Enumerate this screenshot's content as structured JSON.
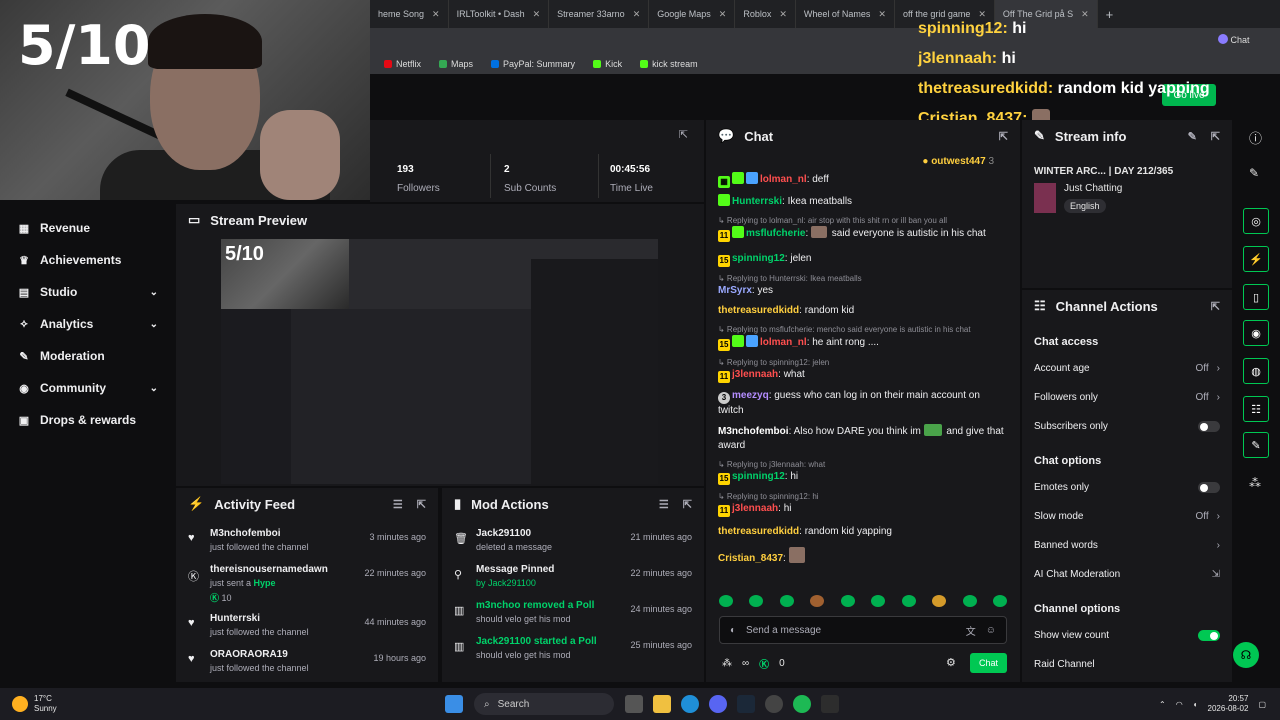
{
  "browser": {
    "tabs": [
      "heme Song",
      "IRLToolkit • Dash",
      "Streamer 33arno",
      "Google Maps",
      "Roblox",
      "Wheel of Names",
      "off the grid game",
      "Off The Grid på S"
    ],
    "bookmarks": [
      "Netflix",
      "Maps",
      "PayPal: Summary",
      "Kick",
      "kick stream"
    ],
    "chat_label": "Chat"
  },
  "overlay": {
    "score": "5/10",
    "chat": [
      {
        "user": "spinning12:",
        "msg": "hi"
      },
      {
        "user": "j3lennaah:",
        "msg": "hi"
      },
      {
        "user": "thetreasuredkidd:",
        "msg": "random kid yapping"
      },
      {
        "user": "Cristian_8437:",
        "msg": ""
      }
    ]
  },
  "topbar": {
    "go_live": "Go live"
  },
  "nav": {
    "items": [
      {
        "label": "Revenue",
        "icon": "revenue-icon",
        "chev": false
      },
      {
        "label": "Achievements",
        "icon": "trophy-icon",
        "chev": false
      },
      {
        "label": "Studio",
        "icon": "studio-icon",
        "chev": true
      },
      {
        "label": "Analytics",
        "icon": "analytics-icon",
        "chev": true
      },
      {
        "label": "Moderation",
        "icon": "wrench-icon",
        "chev": false
      },
      {
        "label": "Community",
        "icon": "community-icon",
        "chev": true
      },
      {
        "label": "Drops & rewards",
        "icon": "gift-icon",
        "chev": false
      }
    ]
  },
  "stats": [
    {
      "value": "193",
      "label": "Followers"
    },
    {
      "value": "2",
      "label": "Sub Counts"
    },
    {
      "value": "00:45:56",
      "label": "Time Live"
    }
  ],
  "preview": {
    "title": "Stream Preview",
    "score": "5/10"
  },
  "activity": {
    "title": "Activity Feed",
    "items": [
      {
        "name": "M3nchofemboi",
        "sub": "just followed the channel",
        "time": "3 minutes ago",
        "icon": "heart-icon",
        "extra": ""
      },
      {
        "name": "thereisnousernamedawn",
        "sub": "just sent a Hype",
        "time": "22 minutes ago",
        "icon": "kick-icon",
        "extra": "10"
      },
      {
        "name": "Hunterrski",
        "sub": "just followed the channel",
        "time": "44 minutes ago",
        "icon": "heart-icon",
        "extra": ""
      },
      {
        "name": "ORAORAORA19",
        "sub": "just followed the channel",
        "time": "19 hours ago",
        "icon": "heart-icon",
        "extra": ""
      }
    ]
  },
  "mod": {
    "title": "Mod Actions",
    "items": [
      {
        "name": "Jack291100",
        "sub": "deleted a message",
        "time": "21 minutes ago",
        "icon": "trash-icon",
        "green": false
      },
      {
        "name": "Message Pinned",
        "sub": "by Jack291100",
        "time": "22 minutes ago",
        "icon": "pin-icon",
        "green": false
      },
      {
        "name": "m3nchoo removed a Poll",
        "sub": "should velo get his mod",
        "time": "24 minutes ago",
        "icon": "poll-icon",
        "green": true
      },
      {
        "name": "Jack291100 started a Poll",
        "sub": "should velo get his mod",
        "time": "25 minutes ago",
        "icon": "poll-icon",
        "green": true
      }
    ]
  },
  "chat": {
    "title": "Chat",
    "pinned_user": "outwest447",
    "pinned_count": "3",
    "input_placeholder": "Send a message",
    "send": "Chat",
    "viewers": "∞",
    "points": "0"
  },
  "info": {
    "title": "Stream info",
    "stream_title": "WINTER ARC... | DAY 212/365",
    "category": "Just Chatting",
    "language": "English"
  },
  "actions": {
    "title": "Channel Actions",
    "s1": "Chat access",
    "account_age": "Account age",
    "account_age_val": "Off",
    "followers_only": "Followers only",
    "followers_only_val": "Off",
    "subscribers_only": "Subscribers only",
    "s2": "Chat options",
    "emotes_only": "Emotes only",
    "slow_mode": "Slow mode",
    "slow_mode_val": "Off",
    "banned_words": "Banned words",
    "ai_mod": "AI Chat Moderation",
    "s3": "Channel options",
    "show_view_count": "Show view count",
    "raid": "Raid Channel"
  },
  "taskbar": {
    "weather_temp": "17°C",
    "weather": "Sunny",
    "search": "Search",
    "time": "20:57",
    "date": "2026-08-02"
  }
}
